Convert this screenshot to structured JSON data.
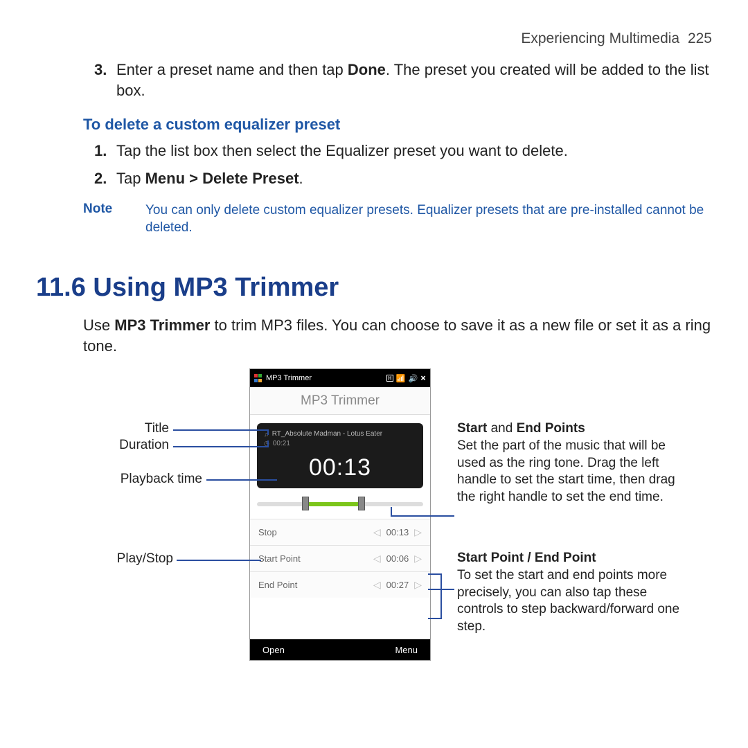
{
  "header": {
    "chapter": "Experiencing Multimedia",
    "page": "225"
  },
  "top_step": {
    "num": "3.",
    "pre": "Enter a preset name and then tap ",
    "bold": "Done",
    "post": ". The preset you created will be added to the list box."
  },
  "delete_heading": "To delete a custom equalizer preset",
  "delete_steps": {
    "s1": {
      "num": "1.",
      "text": "Tap the list box then select the Equalizer preset you want to delete."
    },
    "s2": {
      "num": "2.",
      "pre": "Tap ",
      "bold": "Menu > Delete Preset",
      "post": "."
    }
  },
  "note": {
    "label": "Note",
    "text": "You can only delete custom equalizer presets. Equalizer presets that are pre-installed cannot be deleted."
  },
  "section_title": "11.6  Using MP3 Trimmer",
  "intro": {
    "pre": "Use ",
    "bold": "MP3 Trimmer",
    "post": " to trim MP3 files. You can choose to save it as a new file or set it as a ring tone."
  },
  "phone": {
    "topbar_title": "MP3 Trimmer",
    "status": {
      "h": "H",
      "x": "×"
    },
    "screen_title": "MP3 Trimmer",
    "track_title": "RT_Absolute Madman - Lotus Eater",
    "track_duration": "00:21",
    "play_time": "00:13",
    "rows": {
      "stop": {
        "label": "Stop",
        "val": "00:13"
      },
      "start": {
        "label": "Start Point",
        "val": "00:06"
      },
      "end": {
        "label": "End Point",
        "val": "00:27"
      }
    },
    "bottom": {
      "open": "Open",
      "menu": "Menu"
    }
  },
  "left_labels": {
    "title": "Title",
    "duration": "Duration",
    "playback": "Playback time",
    "playstop": "Play/Stop"
  },
  "right_callouts": {
    "c1": {
      "hd_a": "Start",
      "hd_mid": " and ",
      "hd_b": "End Points",
      "body": "Set the part of the music that will be used as the ring tone. Drag the left handle to set the start time, then drag the right handle to set the end time."
    },
    "c2": {
      "hd": "Start Point / End Point",
      "body": "To set the start and end points more precisely, you can also tap these controls to step backward/forward one step."
    }
  },
  "glyphs": {
    "note": "♫",
    "clock": "◷",
    "left": "◁",
    "right": "▷",
    "bars": "▮▯",
    "spk": "📶"
  }
}
